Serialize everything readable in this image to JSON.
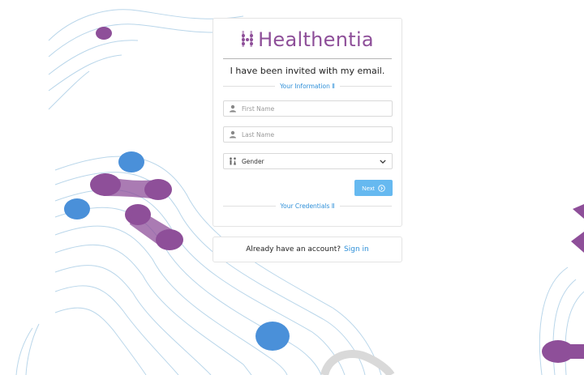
{
  "brand": {
    "name": "Healthentia",
    "color": "#8e4f99"
  },
  "form": {
    "invite_text": "I have been invited with my email.",
    "section_info": "Your Information Ⅱ",
    "first_name_placeholder": "First Name",
    "last_name_placeholder": "Last Name",
    "gender_value": "Gender",
    "next_label": "Next",
    "section_credentials": "Your Credentials Ⅱ"
  },
  "signin": {
    "prompt": "Already have an account?",
    "link": "Sign in"
  },
  "colors": {
    "accent_blue": "#2e8fd8",
    "button_blue": "#66b9f0",
    "decor_purple": "#8e4f99",
    "decor_blue": "#4a90d9",
    "contour_line": "#b9d6ea"
  },
  "icons": {
    "user": "user-icon",
    "gender": "gender-icon",
    "next": "arrow-circle-right-icon",
    "dropdown": "chevron-down-icon"
  }
}
